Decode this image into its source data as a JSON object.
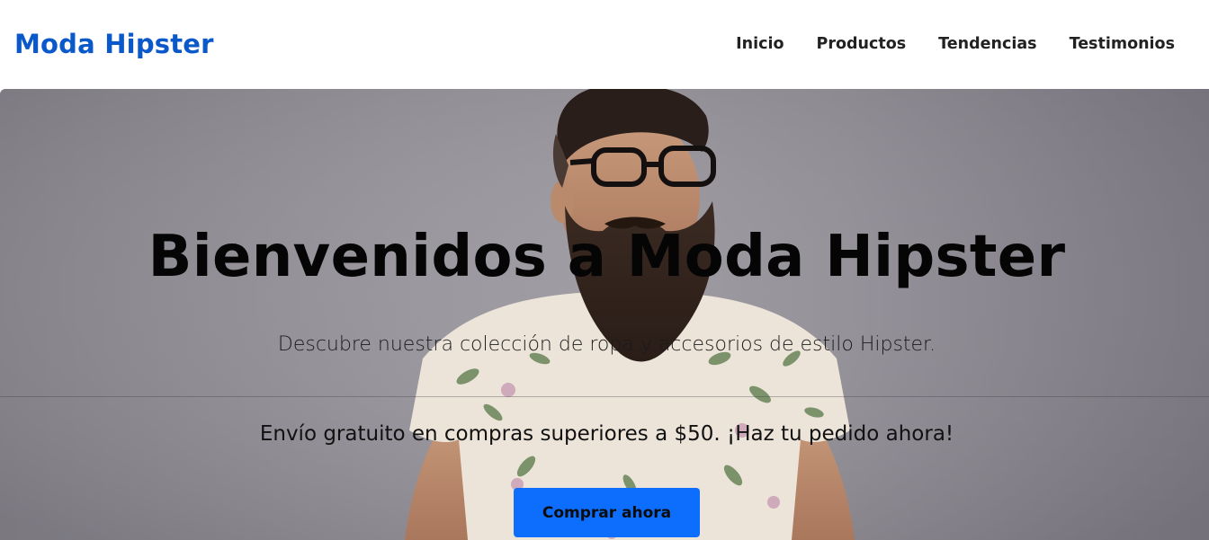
{
  "header": {
    "brand": "Moda Hipster",
    "nav": [
      "Inicio",
      "Productos",
      "Tendencias",
      "Testimonios"
    ]
  },
  "hero": {
    "title": "Bienvenidos a Moda Hipster",
    "subtitle": "Descubre nuestra colección de ropa y accesorios de estilo Hipster.",
    "promo": "Envío gratuito en compras superiores a $50. ¡Haz tu pedido ahora!",
    "cta_label": "Comprar ahora",
    "image_description_icon": "bearded-man-photo"
  },
  "colors": {
    "brand": "#0a58ca",
    "cta": "#0d6efd",
    "nav_text": "#222222"
  }
}
